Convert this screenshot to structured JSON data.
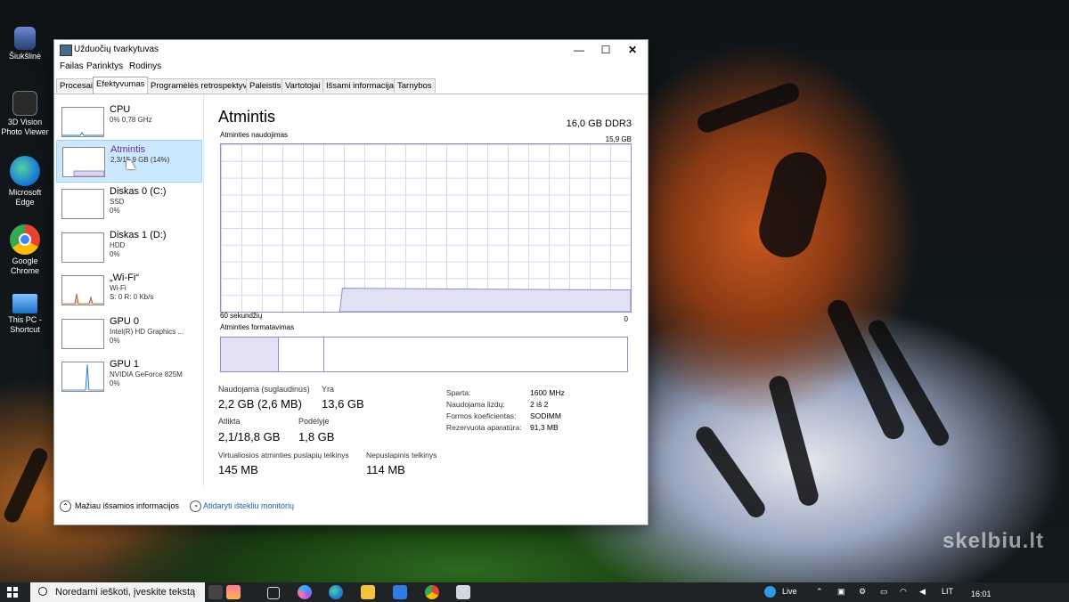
{
  "desktop": {
    "icons": [
      {
        "label": "Šiukšlinė",
        "icon": "recycle-bin-icon"
      },
      {
        "label": "3D Vision Photo Viewer",
        "icon": "3d-vision-icon"
      },
      {
        "label": "Microsoft Edge",
        "icon": "edge-icon"
      },
      {
        "label": "Google Chrome",
        "icon": "chrome-icon"
      },
      {
        "label": "This PC - Shortcut",
        "icon": "this-pc-icon"
      }
    ],
    "watermark": "skelbiu.lt"
  },
  "window": {
    "title": "Užduočių tvarkytuvas",
    "controls": {
      "minimize": "—",
      "maximize": "☐",
      "close": "✕"
    },
    "menu": [
      "Failas",
      "Parinktys",
      "Rodinys"
    ],
    "tabs": [
      "Procesai",
      "Efektyvumas",
      "Programėlės retrospektyva",
      "Paleistis",
      "Vartotojai",
      "Išsami informacija",
      "Tarnybos"
    ],
    "active_tab": "Efektyvumas"
  },
  "resources": [
    {
      "name": "CPU",
      "line2": "0% 0,78 GHz",
      "line3": ""
    },
    {
      "name": "Atmintis",
      "line2": "2,3/15,9 GB (14%)",
      "line3": ""
    },
    {
      "name": "Diskas 0 (C:)",
      "line2": "SSD",
      "line3": "0%"
    },
    {
      "name": "Diskas 1 (D:)",
      "line2": "HDD",
      "line3": "0%"
    },
    {
      "name": "„Wi-Fi“",
      "line2": "Wi-Fi",
      "line3": "S: 0 R: 0 Kb/s"
    },
    {
      "name": "GPU 0",
      "line2": "Intel(R) HD Graphics ...",
      "line3": "0%"
    },
    {
      "name": "GPU 1",
      "line2": "NVIDIA GeForce 825M",
      "line3": "0%"
    }
  ],
  "memory": {
    "title": "Atmintis",
    "type": "16,0 GB DDR3",
    "usage_label": "Atminties naudojimas",
    "max_label": "15,9 GB",
    "axis_left": "60 sekundžių",
    "axis_right": "0",
    "composition_label": "Atminties formatavimas",
    "usage_fraction": 0.14,
    "stats": {
      "in_use_label": "Naudojama (suglaudinus)",
      "in_use_value": "2,2 GB (2,6 MB)",
      "available_label": "Yra",
      "available_value": "13,6 GB",
      "committed_label": "Atlikta",
      "committed_value": "2,1/18,8 GB",
      "cached_label": "Podėlyje",
      "cached_value": "1,8 GB",
      "paged_label": "Virtualiosios atminties puslapių telkinys",
      "paged_value": "145 MB",
      "nonpaged_label": "Nepuslapinis telkinys",
      "nonpaged_value": "114 MB"
    },
    "details": [
      {
        "key": "Sparta:",
        "value": "1600 MHz"
      },
      {
        "key": "Naudojama lizdų:",
        "value": "2 iš 2"
      },
      {
        "key": "Formos koeficientas:",
        "value": "SODIMM"
      },
      {
        "key": "Rezervuota aparatūra:",
        "value": "91,3 MB"
      }
    ]
  },
  "footer": {
    "fewer_details": "Mažiau išsamios informacijos",
    "open_monitor": "Atidaryti ištekliu monitorių"
  },
  "taskbar": {
    "search_placeholder": "Noredami ieškoti, įveskite tekstą",
    "weather": "Live",
    "language": "LIT",
    "time": "16:01"
  }
}
